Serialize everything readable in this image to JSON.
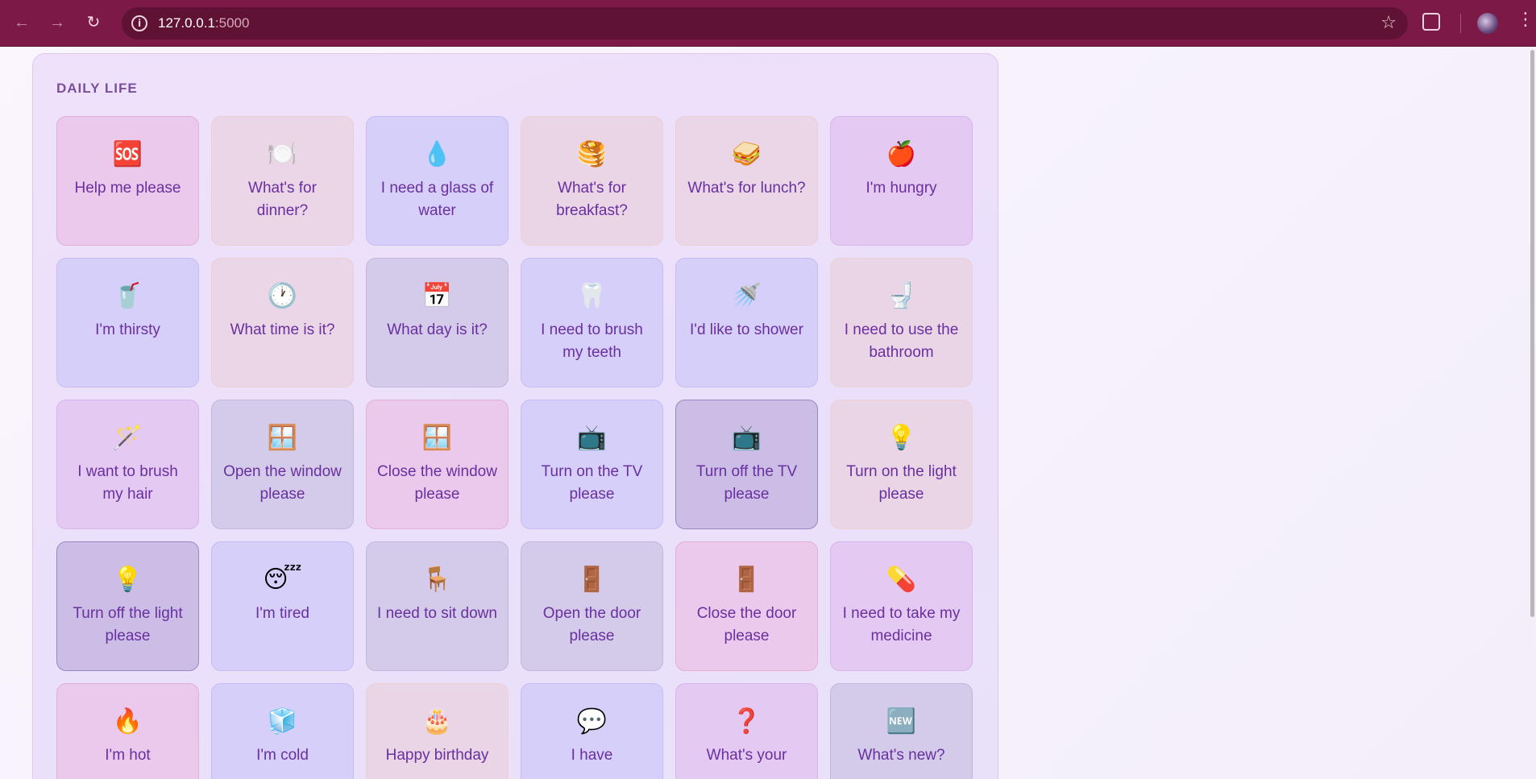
{
  "browser": {
    "url_host": "127.0.0.1",
    "url_port": ":5000",
    "back_icon": "arrow-left-icon",
    "forward_icon": "arrow-right-icon",
    "reload_icon": "reload-icon",
    "site_info_icon": "info-icon",
    "bookmark_icon": "star-icon",
    "extensions_icon": "puzzle-icon",
    "menu_icon": "kebab-menu-icon",
    "back_glyph": "←",
    "forward_glyph": "→",
    "reload_glyph": "↻",
    "info_glyph": "i",
    "star_glyph": "☆",
    "menu_glyph": "⋮"
  },
  "section": {
    "title": "DAILY LIFE"
  },
  "tiles": [
    {
      "emoji": "🆘",
      "label": "Help me please",
      "color": "pink"
    },
    {
      "emoji": "🍽️",
      "label": "What's for dinner?",
      "color": "beige"
    },
    {
      "emoji": "💧",
      "label": "I need a glass of water",
      "color": "blue"
    },
    {
      "emoji": "🥞",
      "label": "What's for breakfast?",
      "color": "peach"
    },
    {
      "emoji": "🥪",
      "label": "What's for lunch?",
      "color": "beige"
    },
    {
      "emoji": "🍎",
      "label": "I'm hungry",
      "color": "purple"
    },
    {
      "emoji": "🥤",
      "label": "I'm thirsty",
      "color": "blue"
    },
    {
      "emoji": "🕐",
      "label": "What time is it?",
      "color": "beige"
    },
    {
      "emoji": "📅",
      "label": "What day is it?",
      "color": "slate"
    },
    {
      "emoji": "🦷",
      "label": "I need to brush my teeth",
      "color": "blue"
    },
    {
      "emoji": "🚿",
      "label": "I'd like to shower",
      "color": "blue"
    },
    {
      "emoji": "🚽",
      "label": "I need to use the bathroom",
      "color": "peach"
    },
    {
      "emoji": "🪄",
      "label": "I want to brush my hair",
      "color": "purple"
    },
    {
      "emoji": "🪟",
      "label": "Open the window please",
      "color": "slate"
    },
    {
      "emoji": "🪟",
      "label": "Close the window please",
      "color": "pink"
    },
    {
      "emoji": "📺",
      "label": "Turn on the TV please",
      "color": "blue"
    },
    {
      "emoji": "📺",
      "label": "Turn off the TV please",
      "color": "dark"
    },
    {
      "emoji": "💡",
      "label": "Turn on the light please",
      "color": "peach"
    },
    {
      "emoji": "💡",
      "label": "Turn off the light please",
      "color": "dark"
    },
    {
      "emoji": "😴",
      "label": "I'm tired",
      "color": "blue"
    },
    {
      "emoji": "🪑",
      "label": "I need to sit down",
      "color": "slate"
    },
    {
      "emoji": "🚪",
      "label": "Open the door please",
      "color": "slate"
    },
    {
      "emoji": "🚪",
      "label": "Close the door please",
      "color": "pink"
    },
    {
      "emoji": "💊",
      "label": "I need to take my medicine",
      "color": "purple"
    },
    {
      "emoji": "🔥",
      "label": "I'm hot",
      "color": "pink"
    },
    {
      "emoji": "🧊",
      "label": "I'm cold",
      "color": "blue"
    },
    {
      "emoji": "🎂",
      "label": "Happy birthday",
      "color": "peach"
    },
    {
      "emoji": "💬",
      "label": "I have",
      "color": "blue"
    },
    {
      "emoji": "❓",
      "label": "What's your",
      "color": "purple"
    },
    {
      "emoji": "🆕",
      "label": "What's new?",
      "color": "slate"
    }
  ]
}
